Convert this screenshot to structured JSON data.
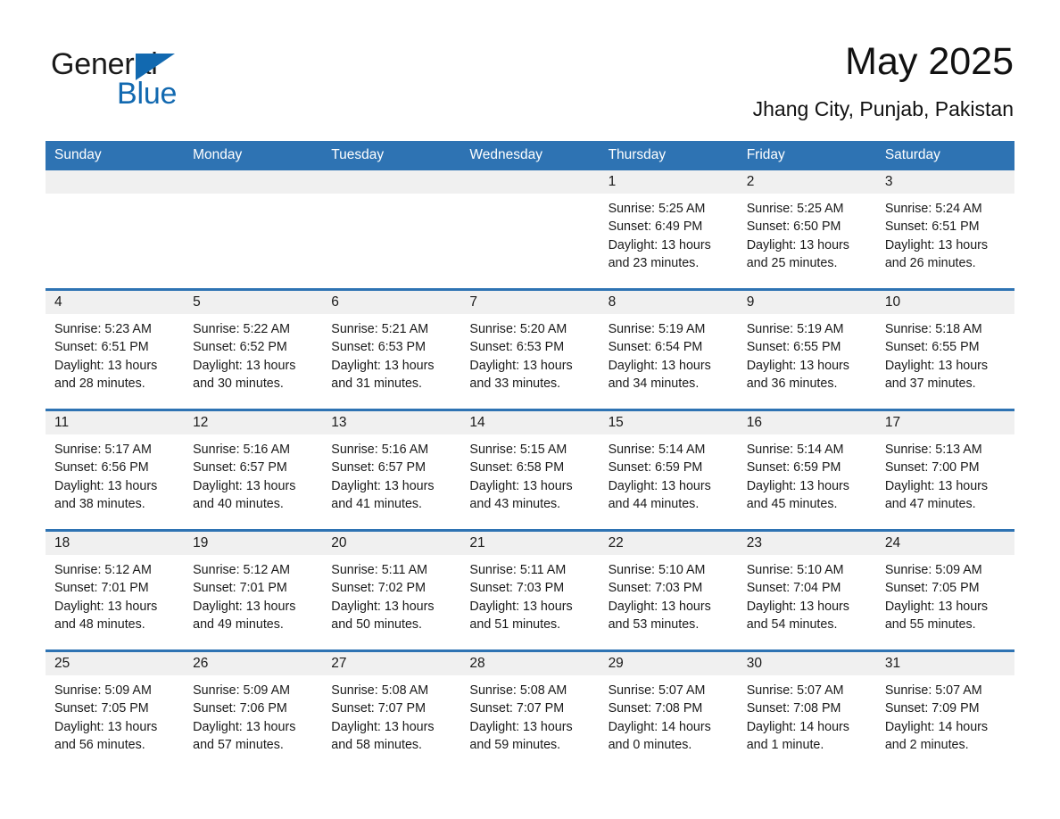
{
  "brand": {
    "name_part1": "General",
    "name_part2": "Blue",
    "accent_color": "#1269b0",
    "triangle_icon": "triangle-icon"
  },
  "header": {
    "month_title": "May 2025",
    "location": "Jhang City, Punjab, Pakistan"
  },
  "theme": {
    "header_blue": "#2e73b3",
    "daynum_band": "#f0f0f0"
  },
  "weekdays": [
    "Sunday",
    "Monday",
    "Tuesday",
    "Wednesday",
    "Thursday",
    "Friday",
    "Saturday"
  ],
  "weeks": [
    [
      {
        "day": "",
        "sunrise": "",
        "sunset": "",
        "daylight_line1": "",
        "daylight_line2": ""
      },
      {
        "day": "",
        "sunrise": "",
        "sunset": "",
        "daylight_line1": "",
        "daylight_line2": ""
      },
      {
        "day": "",
        "sunrise": "",
        "sunset": "",
        "daylight_line1": "",
        "daylight_line2": ""
      },
      {
        "day": "",
        "sunrise": "",
        "sunset": "",
        "daylight_line1": "",
        "daylight_line2": ""
      },
      {
        "day": "1",
        "sunrise": "Sunrise: 5:25 AM",
        "sunset": "Sunset: 6:49 PM",
        "daylight_line1": "Daylight: 13 hours",
        "daylight_line2": "and 23 minutes."
      },
      {
        "day": "2",
        "sunrise": "Sunrise: 5:25 AM",
        "sunset": "Sunset: 6:50 PM",
        "daylight_line1": "Daylight: 13 hours",
        "daylight_line2": "and 25 minutes."
      },
      {
        "day": "3",
        "sunrise": "Sunrise: 5:24 AM",
        "sunset": "Sunset: 6:51 PM",
        "daylight_line1": "Daylight: 13 hours",
        "daylight_line2": "and 26 minutes."
      }
    ],
    [
      {
        "day": "4",
        "sunrise": "Sunrise: 5:23 AM",
        "sunset": "Sunset: 6:51 PM",
        "daylight_line1": "Daylight: 13 hours",
        "daylight_line2": "and 28 minutes."
      },
      {
        "day": "5",
        "sunrise": "Sunrise: 5:22 AM",
        "sunset": "Sunset: 6:52 PM",
        "daylight_line1": "Daylight: 13 hours",
        "daylight_line2": "and 30 minutes."
      },
      {
        "day": "6",
        "sunrise": "Sunrise: 5:21 AM",
        "sunset": "Sunset: 6:53 PM",
        "daylight_line1": "Daylight: 13 hours",
        "daylight_line2": "and 31 minutes."
      },
      {
        "day": "7",
        "sunrise": "Sunrise: 5:20 AM",
        "sunset": "Sunset: 6:53 PM",
        "daylight_line1": "Daylight: 13 hours",
        "daylight_line2": "and 33 minutes."
      },
      {
        "day": "8",
        "sunrise": "Sunrise: 5:19 AM",
        "sunset": "Sunset: 6:54 PM",
        "daylight_line1": "Daylight: 13 hours",
        "daylight_line2": "and 34 minutes."
      },
      {
        "day": "9",
        "sunrise": "Sunrise: 5:19 AM",
        "sunset": "Sunset: 6:55 PM",
        "daylight_line1": "Daylight: 13 hours",
        "daylight_line2": "and 36 minutes."
      },
      {
        "day": "10",
        "sunrise": "Sunrise: 5:18 AM",
        "sunset": "Sunset: 6:55 PM",
        "daylight_line1": "Daylight: 13 hours",
        "daylight_line2": "and 37 minutes."
      }
    ],
    [
      {
        "day": "11",
        "sunrise": "Sunrise: 5:17 AM",
        "sunset": "Sunset: 6:56 PM",
        "daylight_line1": "Daylight: 13 hours",
        "daylight_line2": "and 38 minutes."
      },
      {
        "day": "12",
        "sunrise": "Sunrise: 5:16 AM",
        "sunset": "Sunset: 6:57 PM",
        "daylight_line1": "Daylight: 13 hours",
        "daylight_line2": "and 40 minutes."
      },
      {
        "day": "13",
        "sunrise": "Sunrise: 5:16 AM",
        "sunset": "Sunset: 6:57 PM",
        "daylight_line1": "Daylight: 13 hours",
        "daylight_line2": "and 41 minutes."
      },
      {
        "day": "14",
        "sunrise": "Sunrise: 5:15 AM",
        "sunset": "Sunset: 6:58 PM",
        "daylight_line1": "Daylight: 13 hours",
        "daylight_line2": "and 43 minutes."
      },
      {
        "day": "15",
        "sunrise": "Sunrise: 5:14 AM",
        "sunset": "Sunset: 6:59 PM",
        "daylight_line1": "Daylight: 13 hours",
        "daylight_line2": "and 44 minutes."
      },
      {
        "day": "16",
        "sunrise": "Sunrise: 5:14 AM",
        "sunset": "Sunset: 6:59 PM",
        "daylight_line1": "Daylight: 13 hours",
        "daylight_line2": "and 45 minutes."
      },
      {
        "day": "17",
        "sunrise": "Sunrise: 5:13 AM",
        "sunset": "Sunset: 7:00 PM",
        "daylight_line1": "Daylight: 13 hours",
        "daylight_line2": "and 47 minutes."
      }
    ],
    [
      {
        "day": "18",
        "sunrise": "Sunrise: 5:12 AM",
        "sunset": "Sunset: 7:01 PM",
        "daylight_line1": "Daylight: 13 hours",
        "daylight_line2": "and 48 minutes."
      },
      {
        "day": "19",
        "sunrise": "Sunrise: 5:12 AM",
        "sunset": "Sunset: 7:01 PM",
        "daylight_line1": "Daylight: 13 hours",
        "daylight_line2": "and 49 minutes."
      },
      {
        "day": "20",
        "sunrise": "Sunrise: 5:11 AM",
        "sunset": "Sunset: 7:02 PM",
        "daylight_line1": "Daylight: 13 hours",
        "daylight_line2": "and 50 minutes."
      },
      {
        "day": "21",
        "sunrise": "Sunrise: 5:11 AM",
        "sunset": "Sunset: 7:03 PM",
        "daylight_line1": "Daylight: 13 hours",
        "daylight_line2": "and 51 minutes."
      },
      {
        "day": "22",
        "sunrise": "Sunrise: 5:10 AM",
        "sunset": "Sunset: 7:03 PM",
        "daylight_line1": "Daylight: 13 hours",
        "daylight_line2": "and 53 minutes."
      },
      {
        "day": "23",
        "sunrise": "Sunrise: 5:10 AM",
        "sunset": "Sunset: 7:04 PM",
        "daylight_line1": "Daylight: 13 hours",
        "daylight_line2": "and 54 minutes."
      },
      {
        "day": "24",
        "sunrise": "Sunrise: 5:09 AM",
        "sunset": "Sunset: 7:05 PM",
        "daylight_line1": "Daylight: 13 hours",
        "daylight_line2": "and 55 minutes."
      }
    ],
    [
      {
        "day": "25",
        "sunrise": "Sunrise: 5:09 AM",
        "sunset": "Sunset: 7:05 PM",
        "daylight_line1": "Daylight: 13 hours",
        "daylight_line2": "and 56 minutes."
      },
      {
        "day": "26",
        "sunrise": "Sunrise: 5:09 AM",
        "sunset": "Sunset: 7:06 PM",
        "daylight_line1": "Daylight: 13 hours",
        "daylight_line2": "and 57 minutes."
      },
      {
        "day": "27",
        "sunrise": "Sunrise: 5:08 AM",
        "sunset": "Sunset: 7:07 PM",
        "daylight_line1": "Daylight: 13 hours",
        "daylight_line2": "and 58 minutes."
      },
      {
        "day": "28",
        "sunrise": "Sunrise: 5:08 AM",
        "sunset": "Sunset: 7:07 PM",
        "daylight_line1": "Daylight: 13 hours",
        "daylight_line2": "and 59 minutes."
      },
      {
        "day": "29",
        "sunrise": "Sunrise: 5:07 AM",
        "sunset": "Sunset: 7:08 PM",
        "daylight_line1": "Daylight: 14 hours",
        "daylight_line2": "and 0 minutes."
      },
      {
        "day": "30",
        "sunrise": "Sunrise: 5:07 AM",
        "sunset": "Sunset: 7:08 PM",
        "daylight_line1": "Daylight: 14 hours",
        "daylight_line2": "and 1 minute."
      },
      {
        "day": "31",
        "sunrise": "Sunrise: 5:07 AM",
        "sunset": "Sunset: 7:09 PM",
        "daylight_line1": "Daylight: 14 hours",
        "daylight_line2": "and 2 minutes."
      }
    ]
  ]
}
